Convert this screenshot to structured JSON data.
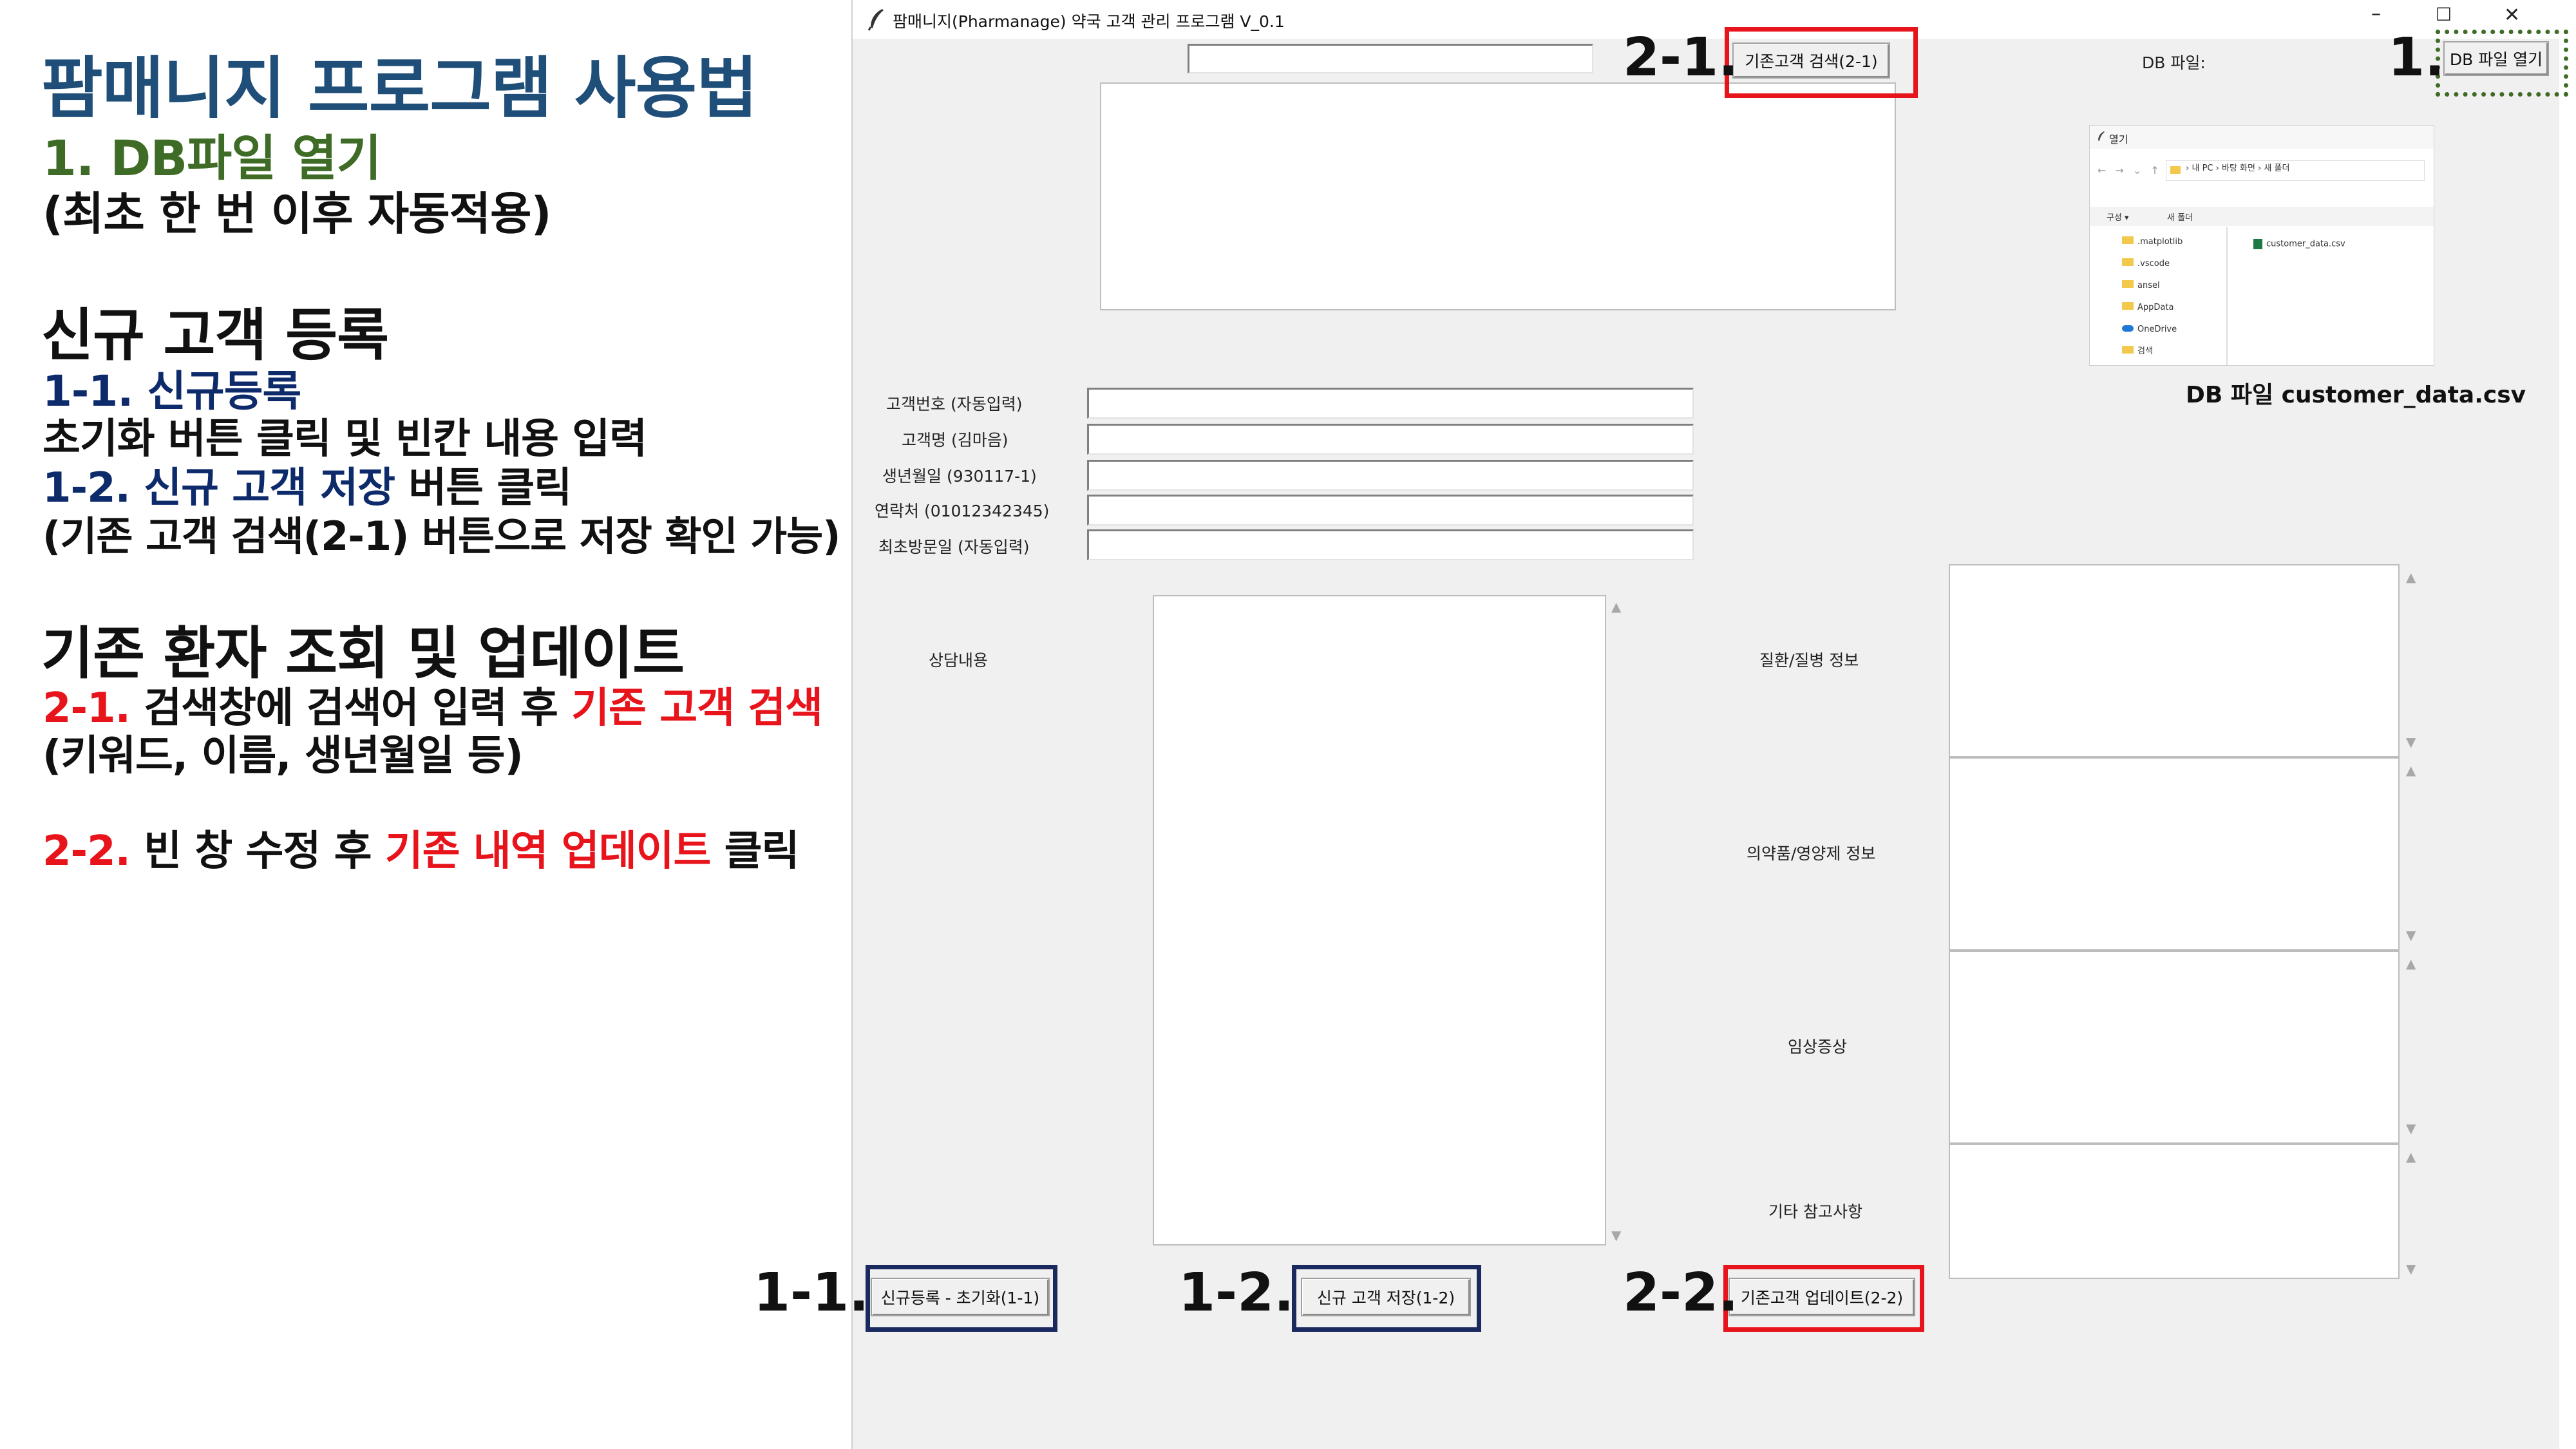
{
  "guide": {
    "title": "팜매니지 프로그램 사용법",
    "step1": {
      "num": "1.",
      "text": "DB파일 열기"
    },
    "step1_note": "(최초 한 번 이후 자동적용)",
    "register_heading": "신규 고객 등록",
    "step11": {
      "num": "1-1.",
      "text": "신규등록"
    },
    "step11_desc": "초기화 버튼 클릭 및 빈칸 내용 입력",
    "step12": {
      "num": "1-2.",
      "emph": "신규 고객 저장",
      "rest": "버튼 클릭"
    },
    "step12_note": "(기존 고객 검색(2-1) 버튼으로 저장 확인 가능)",
    "lookup_heading": "기존 환자 조회 및 업데이트",
    "step21": {
      "num": "2-1.",
      "text": "검색창에 검색어 입력 후",
      "emph": "기존 고객 검색"
    },
    "step21_note": "(키워드, 이름, 생년월일 등)",
    "step22": {
      "num": "2-2.",
      "text": "빈 창 수정 후",
      "emph": "기존 내역 업데이트",
      "rest": "클릭"
    }
  },
  "window": {
    "title": "팜매니지(Pharmanage) 약국 고객 관리 프로그램 V_0.1",
    "controls": {
      "minimize": "–",
      "maximize": "☐",
      "close": "✕"
    }
  },
  "search": {
    "value": "",
    "button": "기존고객 검색(2-1)"
  },
  "db": {
    "label": "DB 파일:",
    "open_button": "DB 파일 열기",
    "caption": "DB 파일 customer_data.csv"
  },
  "file_dialog": {
    "title": "열기",
    "path": [
      "내 PC",
      "바탕 화면",
      "새 폴더"
    ],
    "organize": "구성 ▾",
    "new_folder": "새 폴더",
    "folders": [
      ".matplotlib",
      ".vscode",
      "ansel",
      "AppData",
      "OneDrive",
      "검색"
    ],
    "file": "customer_data.csv"
  },
  "form": {
    "fields": [
      {
        "label": "고객번호 (자동입력)",
        "value": ""
      },
      {
        "label": "고객명 (김마음)",
        "value": ""
      },
      {
        "label": "생년월일 (930117-1)",
        "value": ""
      },
      {
        "label": "연락처 (01012342345)",
        "value": ""
      },
      {
        "label": "최초방문일 (자동입력)",
        "value": ""
      }
    ],
    "consult_label": "상담내용",
    "side_labels": [
      "질환/질병 정보",
      "의약품/영양제 정보",
      "임상증상",
      "기타 참고사항"
    ]
  },
  "buttons": {
    "init": "신규등록 - 초기화(1-1)",
    "save": "신규 고객 저장(1-2)",
    "update": "기존고객 업데이트(2-2)"
  },
  "markers": {
    "m1": "1.",
    "m21": "2-1.",
    "m11": "1-1.",
    "m12": "1-2.",
    "m22": "2-2."
  },
  "colors": {
    "title": "#1f4e79",
    "green": "#3e6b26",
    "navy": "#0d2a6b",
    "red": "#e8141c"
  }
}
